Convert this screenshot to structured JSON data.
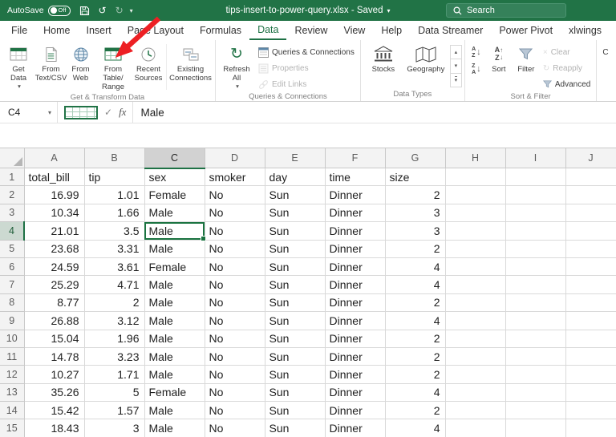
{
  "titlebar": {
    "autosave_label": "AutoSave",
    "autosave_state": "Off",
    "title": "tips-insert-to-power-query.xlsx - Saved",
    "search_label": "Search"
  },
  "ribbon": {
    "active_tab": "Data",
    "tabs": [
      "File",
      "Home",
      "Insert",
      "Page Layout",
      "Formulas",
      "Data",
      "Review",
      "View",
      "Help",
      "Data Streamer",
      "Power Pivot",
      "xlwings"
    ],
    "groups": {
      "get_transform": {
        "label": "Get & Transform Data",
        "get_data": "Get\nData",
        "from_text_csv": "From\nText/CSV",
        "from_web": "From\nWeb",
        "from_table_range": "From Table/\nRange",
        "recent_sources": "Recent\nSources",
        "existing_connections": "Existing\nConnections"
      },
      "queries_connections": {
        "label": "Queries & Connections",
        "refresh_all": "Refresh\nAll",
        "queries": "Queries & Connections",
        "properties": "Properties",
        "edit_links": "Edit Links"
      },
      "data_types": {
        "label": "Data Types",
        "stocks": "Stocks",
        "geography": "Geography"
      },
      "sort_filter": {
        "label": "Sort & Filter",
        "sort": "Sort",
        "filter": "Filter",
        "clear": "Clear",
        "reapply": "Reapply",
        "advanced": "Advanced"
      },
      "clipped_label": "C"
    }
  },
  "formula_bar": {
    "name_box": "C4",
    "fx_label": "fx",
    "value": "Male"
  },
  "sheet": {
    "columns": [
      "A",
      "B",
      "C",
      "D",
      "E",
      "F",
      "G",
      "H",
      "I",
      "J"
    ],
    "header_row": [
      "total_bill",
      "tip",
      "sex",
      "smoker",
      "day",
      "time",
      "size"
    ],
    "rows": [
      [
        16.99,
        1.01,
        "Female",
        "No",
        "Sun",
        "Dinner",
        2
      ],
      [
        10.34,
        1.66,
        "Male",
        "No",
        "Sun",
        "Dinner",
        3
      ],
      [
        21.01,
        3.5,
        "Male",
        "No",
        "Sun",
        "Dinner",
        3
      ],
      [
        23.68,
        3.31,
        "Male",
        "No",
        "Sun",
        "Dinner",
        2
      ],
      [
        24.59,
        3.61,
        "Female",
        "No",
        "Sun",
        "Dinner",
        4
      ],
      [
        25.29,
        4.71,
        "Male",
        "No",
        "Sun",
        "Dinner",
        4
      ],
      [
        8.77,
        2,
        "Male",
        "No",
        "Sun",
        "Dinner",
        2
      ],
      [
        26.88,
        3.12,
        "Male",
        "No",
        "Sun",
        "Dinner",
        4
      ],
      [
        15.04,
        1.96,
        "Male",
        "No",
        "Sun",
        "Dinner",
        2
      ],
      [
        14.78,
        3.23,
        "Male",
        "No",
        "Sun",
        "Dinner",
        2
      ],
      [
        10.27,
        1.71,
        "Male",
        "No",
        "Sun",
        "Dinner",
        2
      ],
      [
        35.26,
        5,
        "Female",
        "No",
        "Sun",
        "Dinner",
        4
      ],
      [
        15.42,
        1.57,
        "Male",
        "No",
        "Sun",
        "Dinner",
        2
      ],
      [
        18.43,
        3,
        "Male",
        "No",
        "Sun",
        "Dinner",
        4
      ]
    ],
    "selection": {
      "active_cell": "C4",
      "column": "C",
      "row": 4
    }
  },
  "annotation": {
    "arrow_color": "#ed2024"
  },
  "icons": {
    "caret_down": "▾",
    "undo": "↺",
    "redo": "↻",
    "check": "✓",
    "refresh": "↻",
    "gallery_up": "▴",
    "gallery_down": "▾",
    "sort_a": "A",
    "sort_z": "Z",
    "arrow_down": "↓",
    "arrow_up": "↑",
    "clear_x": "×"
  }
}
